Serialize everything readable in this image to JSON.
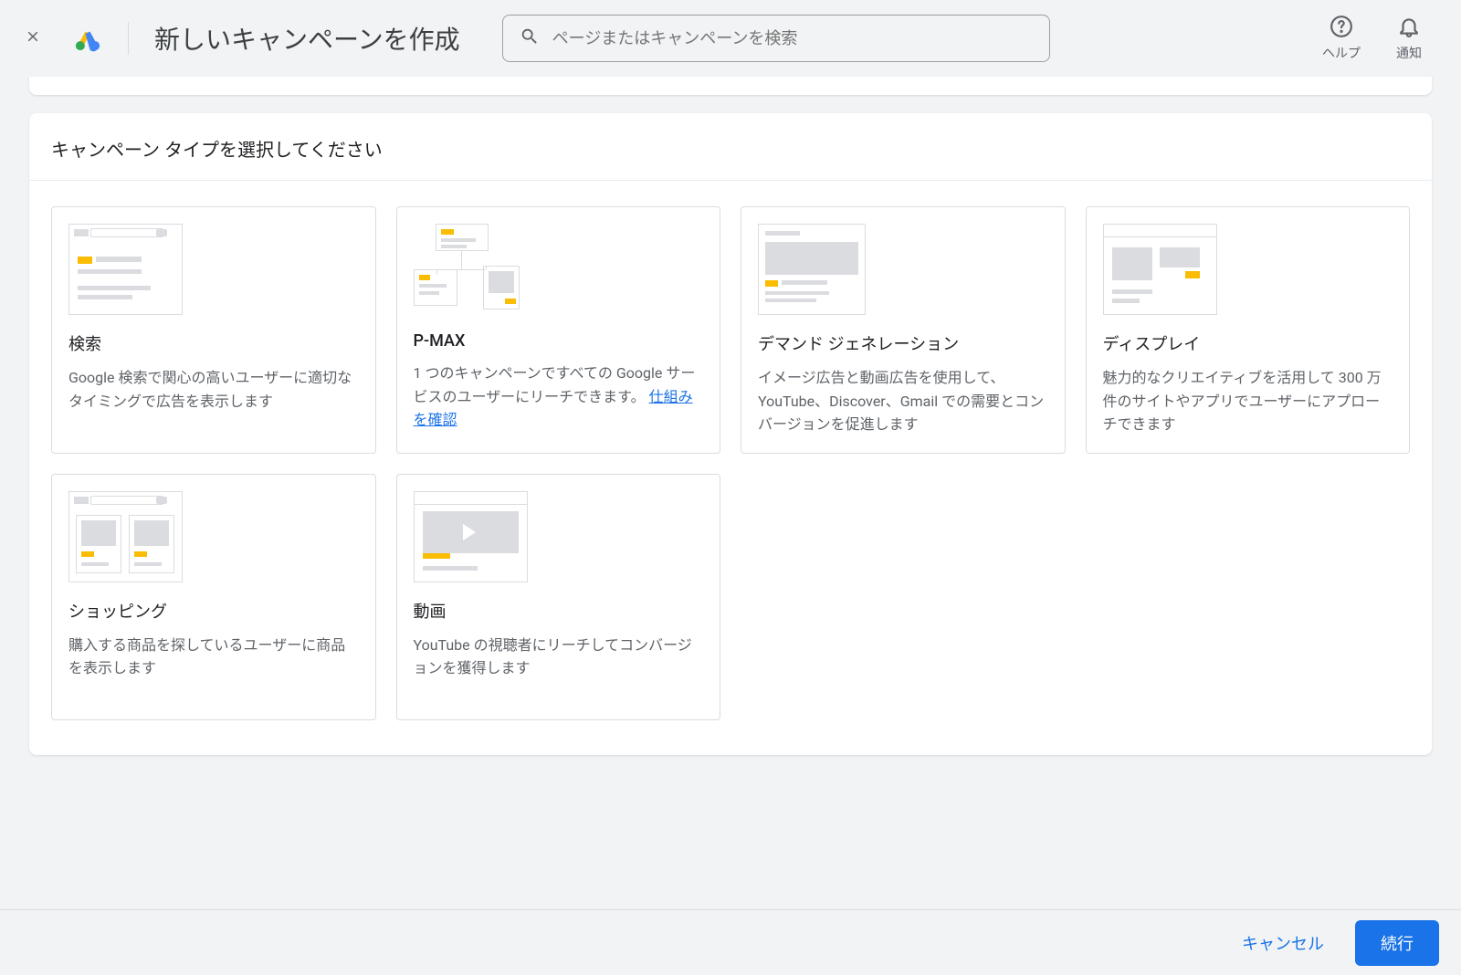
{
  "header": {
    "title": "新しいキャンペーンを作成",
    "search_placeholder": "ページまたはキャンペーンを検索",
    "help_label": "ヘルプ",
    "notifications_label": "通知"
  },
  "section": {
    "title": "キャンペーン タイプを選択してください"
  },
  "cards": {
    "search": {
      "title": "検索",
      "desc": "Google 検索で関心の高いユーザーに適切なタイミングで広告を表示します"
    },
    "pmax": {
      "title": "P-MAX",
      "desc": "1 つのキャンペーンですべての Google サービスのユーザーにリーチできます。 ",
      "link": "仕組みを確認"
    },
    "demand": {
      "title": "デマンド ジェネレーション",
      "desc": "イメージ広告と動画広告を使用して、YouTube、Discover、Gmail での需要とコンバージョンを促進します"
    },
    "display": {
      "title": "ディスプレイ",
      "desc": "魅力的なクリエイティブを活用して 300 万件のサイトやアプリでユーザーにアプローチできます"
    },
    "shopping": {
      "title": "ショッピング",
      "desc": "購入する商品を探しているユーザーに商品を表示します"
    },
    "video": {
      "title": "動画",
      "desc": "YouTube の視聴者にリーチしてコンバージョンを獲得します"
    }
  },
  "footer": {
    "cancel": "キャンセル",
    "continue": "続行"
  }
}
